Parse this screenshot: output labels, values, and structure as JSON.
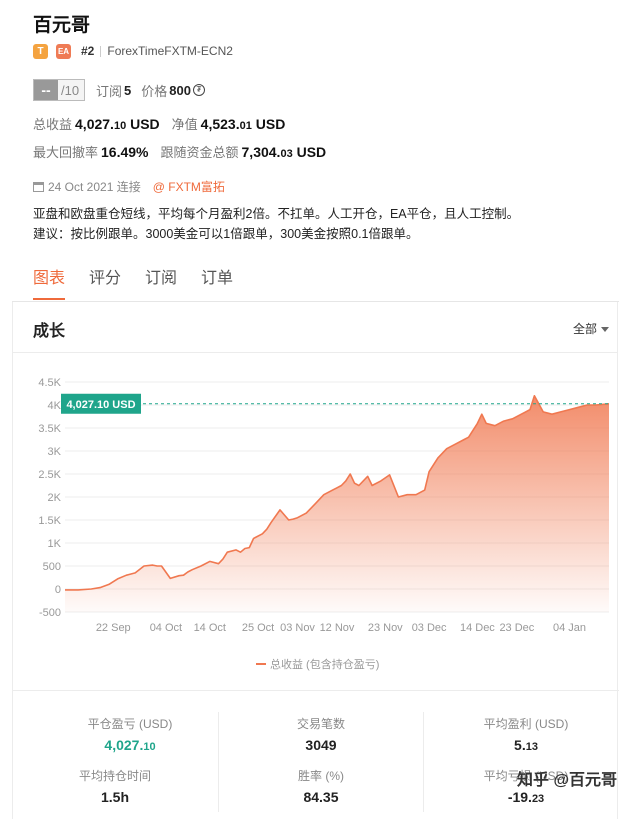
{
  "header": {
    "title": "百元哥",
    "badge_t": "T",
    "badge_ea": "EA",
    "rank": "#2",
    "broker_server": "ForexTimeFXTM-ECN2"
  },
  "score": {
    "value": "--",
    "denominator": "/10"
  },
  "subscriptions": {
    "label": "订阅",
    "value": "5"
  },
  "price": {
    "label": "价格",
    "value": "800",
    "coin": "₮"
  },
  "stats": {
    "total_profit_label": "总收益",
    "total_profit_int": "4,027.",
    "total_profit_dec": "10",
    "total_profit_unit": " USD",
    "net_value_label": "净值",
    "net_value_int": "4,523.",
    "net_value_dec": "01",
    "net_value_unit": " USD",
    "max_drawdown_label": "最大回撤率",
    "max_drawdown_value": "16.49%",
    "follow_funds_label": "跟随资金总额",
    "follow_funds_int": "7,304.",
    "follow_funds_dec": "03",
    "follow_funds_unit": " USD"
  },
  "connected": {
    "date": "24 Oct 2021 连接",
    "broker_link": "@ FXTM富拓"
  },
  "description": {
    "line1": "亚盘和欧盘重仓短线，平均每个月盈利2倍。不扛单。人工开仓，EA平仓，且人工控制。",
    "line2": "建议：按比例跟单。3000美金可以1倍跟单，300美金按照0.1倍跟单。"
  },
  "tabs": [
    "图表",
    "评分",
    "订阅",
    "订单"
  ],
  "panel": {
    "title": "成长",
    "range": "全部"
  },
  "chart_data": {
    "type": "area",
    "ylim": [
      -500,
      4500
    ],
    "yticks": [
      "4.5K",
      "4K",
      "3.5K",
      "3K",
      "2.5K",
      "2K",
      "1.5K",
      "1K",
      "500",
      "0",
      "-500"
    ],
    "ytick_values": [
      4500,
      4000,
      3500,
      3000,
      2500,
      2000,
      1500,
      1000,
      500,
      0,
      -500
    ],
    "xticks": [
      "22 Sep",
      "04 Oct",
      "14 Oct",
      "25 Oct",
      "03 Nov",
      "12 Nov",
      "23 Nov",
      "03 Dec",
      "14 Dec",
      "23 Dec",
      "04 Jan"
    ],
    "xtick_values": [
      11,
      23,
      33,
      44,
      53,
      62,
      73,
      83,
      94,
      103,
      115
    ],
    "x_range": [
      0,
      124
    ],
    "current_value_label": "4,027.10 USD",
    "current_value": 4027.1,
    "legend": "总收益 (包含持仓盈亏)",
    "grid": true,
    "color": "#f07850",
    "series": [
      {
        "name": "总收益 (包含持仓盈亏)",
        "x": [
          0,
          3,
          6,
          8,
          10,
          12,
          14,
          16,
          18,
          20,
          21,
          22,
          24,
          26,
          27,
          28,
          29,
          31,
          33,
          35,
          36,
          37,
          39,
          40,
          41,
          42,
          43,
          45,
          46,
          47,
          49,
          51,
          52,
          53,
          55,
          57,
          59,
          61,
          62,
          63,
          64,
          65,
          66,
          67,
          69,
          70,
          72,
          74,
          76,
          78,
          80,
          82,
          83,
          85,
          87,
          89,
          91,
          92,
          93,
          94,
          95,
          96,
          98,
          100,
          102,
          104,
          105,
          106,
          107,
          109,
          111,
          113,
          115,
          117,
          119,
          121,
          124
        ],
        "y": [
          -20,
          -20,
          0,
          30,
          100,
          220,
          300,
          350,
          500,
          520,
          500,
          500,
          230,
          290,
          300,
          370,
          420,
          500,
          600,
          550,
          650,
          800,
          850,
          800,
          880,
          900,
          1100,
          1200,
          1300,
          1450,
          1720,
          1500,
          1520,
          1550,
          1650,
          1850,
          2050,
          2150,
          2200,
          2250,
          2350,
          2500,
          2300,
          2250,
          2450,
          2250,
          2350,
          2480,
          2000,
          2050,
          2050,
          2150,
          2550,
          2850,
          3050,
          3150,
          3250,
          3300,
          3450,
          3600,
          3800,
          3600,
          3550,
          3650,
          3700,
          3800,
          3850,
          3900,
          4200,
          3850,
          3800,
          3850,
          3900,
          3950,
          4000,
          4000,
          4027
        ]
      }
    ]
  },
  "kpis": [
    {
      "label": "平仓盈亏 (USD)",
      "value_int": "4,027.",
      "value_dec": "10",
      "color": "#1fa58b"
    },
    {
      "label": "交易笔数",
      "value_int": "3049",
      "value_dec": ""
    },
    {
      "label": "平均盈利 (USD)",
      "value_int": "5.",
      "value_dec": "13"
    },
    {
      "label": "平均持仓时间",
      "value_int": "1.5h",
      "value_dec": ""
    },
    {
      "label": "胜率 (%)",
      "value_int": "84.35",
      "value_dec": ""
    },
    {
      "label": "平均亏损 (USD)",
      "value_int": "-19.",
      "value_dec": "23"
    }
  ],
  "watermark": "知乎 @百元哥"
}
